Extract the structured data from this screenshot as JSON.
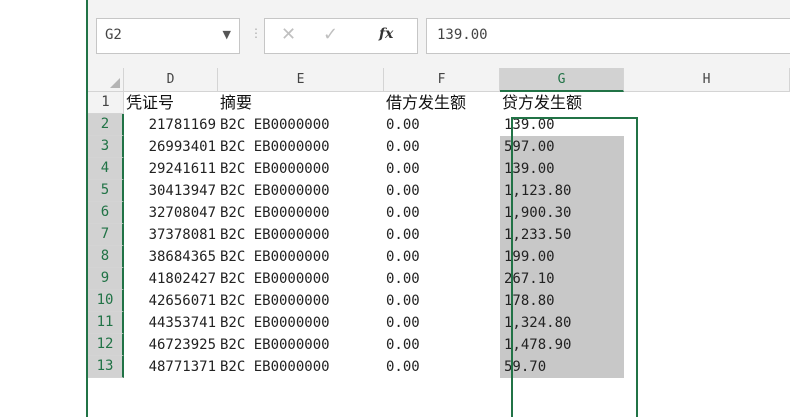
{
  "name_box": {
    "value": "G2"
  },
  "formula_bar": {
    "value": "139.00",
    "fx_label": "fx"
  },
  "columns": [
    "D",
    "E",
    "F",
    "G",
    "H"
  ],
  "selected_column": "G",
  "header_row": {
    "row_num": "1",
    "d": "凭证号",
    "e": "摘要",
    "f": "借方发生额",
    "g": "贷方发生额"
  },
  "rows": [
    {
      "row_num": "2",
      "d": "21781169",
      "e": "B2C  EB0000000",
      "f": "0.00",
      "g": "139.00"
    },
    {
      "row_num": "3",
      "d": "26993401",
      "e": "B2C  EB0000000",
      "f": "0.00",
      "g": "597.00"
    },
    {
      "row_num": "4",
      "d": "29241611",
      "e": "B2C  EB0000000",
      "f": "0.00",
      "g": "139.00"
    },
    {
      "row_num": "5",
      "d": "30413947",
      "e": "B2C  EB0000000",
      "f": "0.00",
      "g": "1,123.80"
    },
    {
      "row_num": "6",
      "d": "32708047",
      "e": "B2C  EB0000000",
      "f": "0.00",
      "g": "1,900.30"
    },
    {
      "row_num": "7",
      "d": "37378081",
      "e": "B2C  EB0000000",
      "f": "0.00",
      "g": "1,233.50"
    },
    {
      "row_num": "8",
      "d": "38684365",
      "e": "B2C  EB0000000",
      "f": "0.00",
      "g": "199.00"
    },
    {
      "row_num": "9",
      "d": "41802427",
      "e": "B2C  EB0000000",
      "f": "0.00",
      "g": "267.10"
    },
    {
      "row_num": "10",
      "d": "42656071",
      "e": "B2C  EB0000000",
      "f": "0.00",
      "g": "178.80"
    },
    {
      "row_num": "11",
      "d": "44353741",
      "e": "B2C  EB0000000",
      "f": "0.00",
      "g": "1,324.80"
    },
    {
      "row_num": "12",
      "d": "46723925",
      "e": "B2C  EB0000000",
      "f": "0.00",
      "g": "1,478.90"
    },
    {
      "row_num": "13",
      "d": "48771371",
      "e": "B2C  EB0000000",
      "f": "0.00",
      "g": "59.70"
    }
  ],
  "colors": {
    "accent": "#217346",
    "selection_shade": "#c8c8c8",
    "header_bg": "#f3f3f3"
  },
  "icons": {
    "cancel": "✕",
    "enter": "✓",
    "dropdown": "▼",
    "separator": "⋮"
  }
}
